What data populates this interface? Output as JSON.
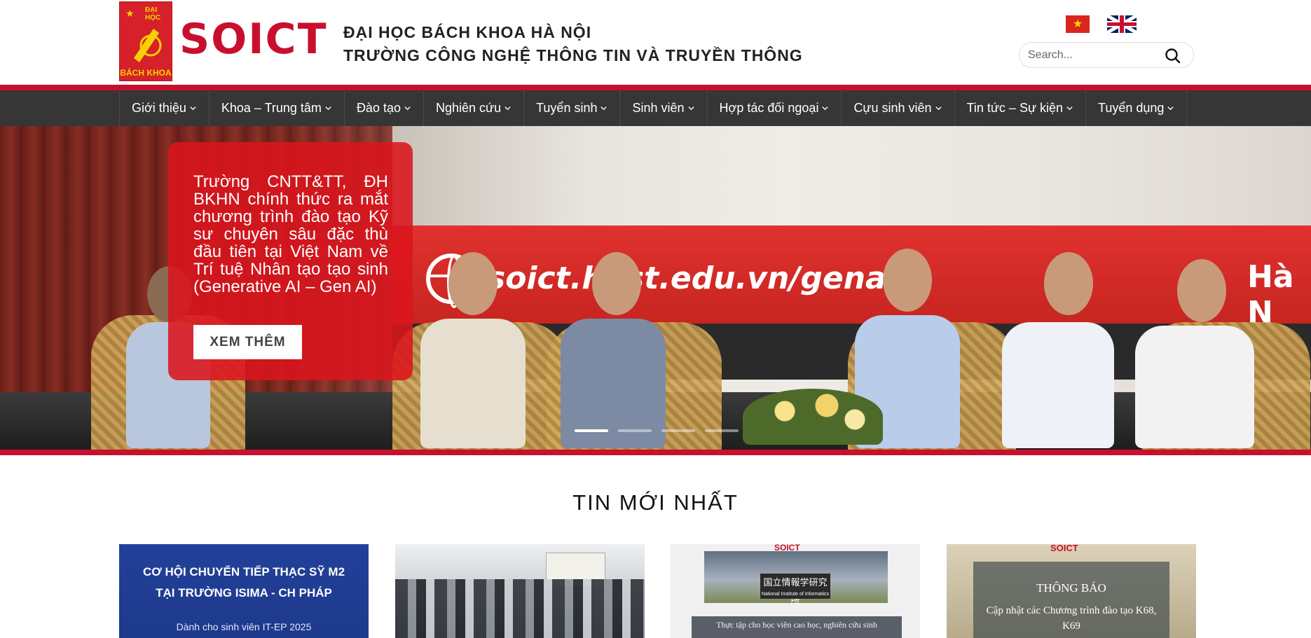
{
  "header": {
    "logo_top": "ĐẠI HỌC",
    "logo_bottom": "BÁCH KHOA",
    "logo_wordmark": "SOICT",
    "university_line1": "ĐẠI HỌC BÁCH KHOA HÀ NỘI",
    "university_line2": "TRƯỜNG CÔNG NGHỆ THÔNG TIN VÀ TRUYỀN THÔNG",
    "search_placeholder": "Search..."
  },
  "nav": {
    "items": [
      {
        "label": "Giới thiệu"
      },
      {
        "label": "Khoa – Trung tâm"
      },
      {
        "label": "Đào tạo"
      },
      {
        "label": "Nghiên cứu"
      },
      {
        "label": "Tuyển sinh"
      },
      {
        "label": "Sinh viên"
      },
      {
        "label": "Hợp tác đối ngoại"
      },
      {
        "label": "Cựu sinh viên"
      },
      {
        "label": "Tin tức – Sự kiện"
      },
      {
        "label": "Tuyển dụng"
      }
    ]
  },
  "hero": {
    "text": "Trường CNTT&TT, ĐH BKHN chính thức ra mắt chương trình đào tạo Kỹ sư chuyên sâu đặc thù đầu tiên tại Việt Nam về Trí tuệ Nhân tạo tạo sinh (Generative AI – Gen AI)",
    "button_label": "XEM THÊM",
    "banner_url": "soict.hust.edu.vn/genai",
    "banner_city": "Hà N",
    "slide_count": 4,
    "active_slide": 1
  },
  "news": {
    "title": "TIN MỚI NHẤT",
    "card1_line1": "CƠ HỘI CHUYỂN TIẾP THẠC SỸ M2",
    "card1_line2": "TẠI TRƯỜNG ISIMA - CH PHÁP",
    "card1_sub": "Dành cho sinh viên IT-EP 2025",
    "card3_logo": "SOICT",
    "card3_label": "国立情報学研究所",
    "card3_label_en": "National Institute of Informatics",
    "card3_caption": "Thực tập cho học viên cao học, nghiên cứu sinh",
    "card4_logo": "SOICT",
    "card4_head": "THÔNG BÁO",
    "card4_text": "Cập nhật các Chương trình đào tạo K68, K69"
  },
  "colors": {
    "brand_red": "#c8102e",
    "nav_bg": "#363636",
    "card_blue": "#23409a"
  }
}
